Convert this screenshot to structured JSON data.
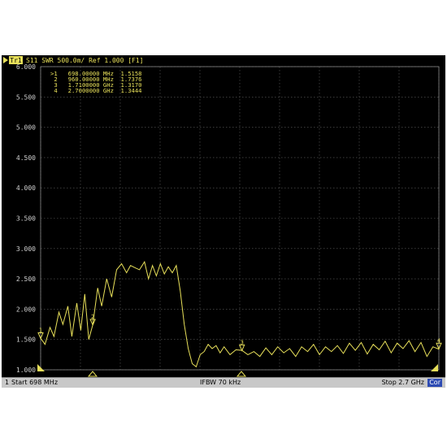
{
  "trace_header": {
    "trace_badge": "Tr1",
    "text": "S11 SWR 500.0m/ Ref 1.000 [F1]"
  },
  "markers": [
    {
      "line": ">1   698.00000 MHz  1.5158",
      "label": "1",
      "freq": "698.00000 MHz",
      "value": 1.5158
    },
    {
      "line": " 2   960.00000 MHz  1.7376",
      "label": "2",
      "freq": "960.00000 MHz",
      "value": 1.7376
    },
    {
      "line": " 3   1.7100000 GHz  1.3170",
      "label": "3",
      "freq": "1.7100000 GHz",
      "value": 1.317
    },
    {
      "line": " 4   2.7000000 GHz  1.3444",
      "label": "4",
      "freq": "2.7000000 GHz",
      "value": 1.3444
    }
  ],
  "status_bar": {
    "channel": "1",
    "start": "Start 698 MHz",
    "ifbw": "IFBW 70 kHz",
    "stop": "Stop 2.7 GHz",
    "correction": "Cor"
  },
  "colors": {
    "background": "#000000",
    "grid": "#5e5e5e",
    "trace": "#e8e05a",
    "status_bar": "#c8c8c8",
    "correction_badge": "#2d4bb3"
  },
  "chart_data": {
    "type": "line",
    "x_unit": "MHz",
    "y_unit": "SWR",
    "xlim": [
      698,
      2700
    ],
    "ylim": [
      1.0,
      6.0
    ],
    "yticks": [
      6.0,
      5.5,
      5.0,
      4.5,
      4.0,
      3.5,
      3.0,
      2.5,
      2.0,
      1.5,
      1.0
    ],
    "ytick_labels": [
      "6.000",
      "5.500",
      "5.000",
      "4.500",
      "4.000",
      "3.500",
      "3.000",
      "2.500",
      "2.000",
      "1.500",
      "1.000"
    ],
    "grid": true,
    "reference_value": 1.0,
    "scale_per_div": 0.5,
    "series": [
      {
        "x": [
          698,
          720,
          745,
          765,
          790,
          810,
          835,
          855,
          880,
          900,
          920,
          940,
          960,
          985,
          1005,
          1030,
          1055,
          1080,
          1105,
          1130,
          1150,
          1175,
          1195,
          1220,
          1240,
          1260,
          1280,
          1300,
          1320,
          1340,
          1360,
          1380,
          1400,
          1420,
          1440,
          1460,
          1480,
          1500,
          1520,
          1540,
          1560,
          1580,
          1600,
          1620,
          1650,
          1680,
          1710,
          1740,
          1770,
          1800,
          1830,
          1860,
          1890,
          1920,
          1950,
          1980,
          2010,
          2040,
          2070,
          2100,
          2130,
          2160,
          2190,
          2220,
          2250,
          2280,
          2310,
          2340,
          2370,
          2400,
          2430,
          2460,
          2490,
          2520,
          2550,
          2580,
          2610,
          2640,
          2670,
          2700
        ],
        "values": [
          1.52,
          1.42,
          1.7,
          1.55,
          1.95,
          1.75,
          2.05,
          1.55,
          2.1,
          1.65,
          2.25,
          1.5,
          1.74,
          2.35,
          2.05,
          2.5,
          2.2,
          2.65,
          2.75,
          2.6,
          2.72,
          2.68,
          2.65,
          2.78,
          2.5,
          2.72,
          2.55,
          2.75,
          2.58,
          2.7,
          2.6,
          2.72,
          2.3,
          1.75,
          1.35,
          1.1,
          1.05,
          1.25,
          1.3,
          1.42,
          1.35,
          1.4,
          1.28,
          1.38,
          1.25,
          1.33,
          1.32,
          1.25,
          1.3,
          1.22,
          1.36,
          1.25,
          1.38,
          1.28,
          1.35,
          1.22,
          1.38,
          1.3,
          1.42,
          1.25,
          1.38,
          1.3,
          1.4,
          1.27,
          1.44,
          1.32,
          1.45,
          1.26,
          1.42,
          1.33,
          1.47,
          1.28,
          1.44,
          1.35,
          1.48,
          1.3,
          1.45,
          1.22,
          1.38,
          1.34
        ]
      }
    ]
  }
}
